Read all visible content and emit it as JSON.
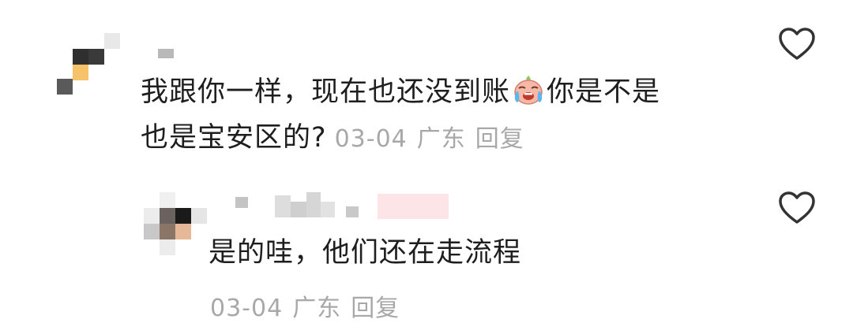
{
  "comments": [
    {
      "text_before_emoji": "我跟你一样，现在也还没到账",
      "text_after_emoji": "你是不是",
      "text_line2": "也是宝安区的?",
      "emoji": "crying-face-emoji",
      "date": "03-04",
      "location": "广东",
      "reply_label": "回复",
      "like_icon": "heart-outline-icon"
    },
    {
      "text": "是的哇，他们还在走流程",
      "date": "03-04",
      "location": "广东",
      "reply_label": "回复",
      "like_icon": "heart-outline-icon"
    }
  ],
  "colors": {
    "text": "#1e1e1e",
    "meta": "#a8a8a8",
    "icon": "#333333"
  }
}
